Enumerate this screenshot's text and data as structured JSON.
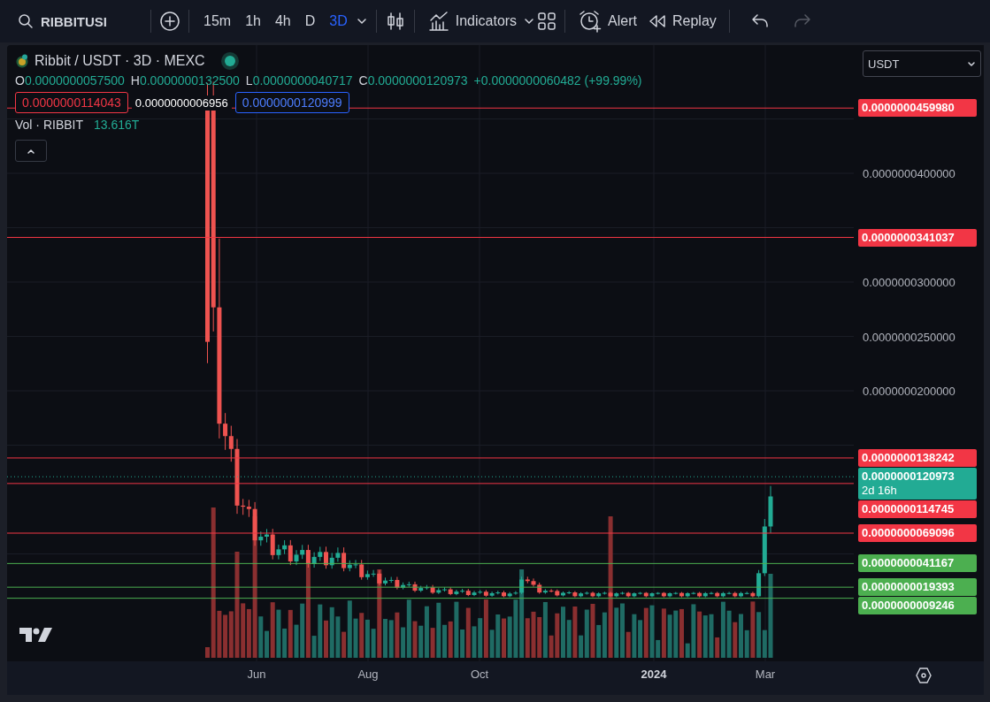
{
  "toolbar": {
    "symbol": "RIBBITUSI",
    "timeframes": [
      {
        "label": "15m",
        "selected": false
      },
      {
        "label": "1h",
        "selected": false
      },
      {
        "label": "4h",
        "selected": false
      },
      {
        "label": "D",
        "selected": false
      },
      {
        "label": "3D",
        "selected": true
      }
    ],
    "indicators": "Indicators",
    "alert": "Alert",
    "replay": "Replay",
    "redo_disabled": true
  },
  "legend": {
    "title": "Ribbit / USDT · 3D · MEXC",
    "ohlc": [
      {
        "label": "O",
        "value": "0.0000000057500"
      },
      {
        "label": "H",
        "value": "0.0000000132500"
      },
      {
        "label": "L",
        "value": "0.0000000040717"
      },
      {
        "label": "C",
        "value": "0.0000000120973"
      }
    ],
    "change": "+0.0000000060482 (+99.99%)",
    "sell": "0.0000000114043",
    "spread": "0.0000000006956",
    "buy": "0.0000000120999",
    "volume_label": "Vol · RIBBIT",
    "volume_value": "13.616T"
  },
  "currency_select": {
    "value": "USDT"
  },
  "price_ticks": [
    "0.0000000400000",
    "0.0000000300000",
    "0.0000000250000",
    "0.0000000200000"
  ],
  "price_labels": [
    {
      "value": "0.0000000459980",
      "color": "#f23645",
      "kind": "alert"
    },
    {
      "value": "0.0000000341037",
      "color": "#f23645",
      "kind": "alert"
    },
    {
      "value": "0.0000000138242",
      "color": "#f23645",
      "kind": "alert"
    },
    {
      "value": "0.0000000120973",
      "color": "#22ab94",
      "kind": "current",
      "countdown": "2d 16h"
    },
    {
      "value": "0.0000000114745",
      "color": "#f23645",
      "kind": "alert"
    },
    {
      "value": "0.0000000069096",
      "color": "#f23645",
      "kind": "alert"
    },
    {
      "value": "0.0000000041167",
      "color": "#4caf50",
      "kind": "alert"
    },
    {
      "value": "0.0000000019393",
      "color": "#4caf50",
      "kind": "alert"
    },
    {
      "value": "0.0000000009246",
      "color": "#4caf50",
      "kind": "alert"
    }
  ],
  "time_labels": [
    {
      "label": "Jun",
      "kind": "month"
    },
    {
      "label": "Aug",
      "kind": "month"
    },
    {
      "label": "Oct",
      "kind": "month"
    },
    {
      "label": "2024",
      "kind": "year"
    },
    {
      "label": "Mar",
      "kind": "month"
    }
  ]
}
